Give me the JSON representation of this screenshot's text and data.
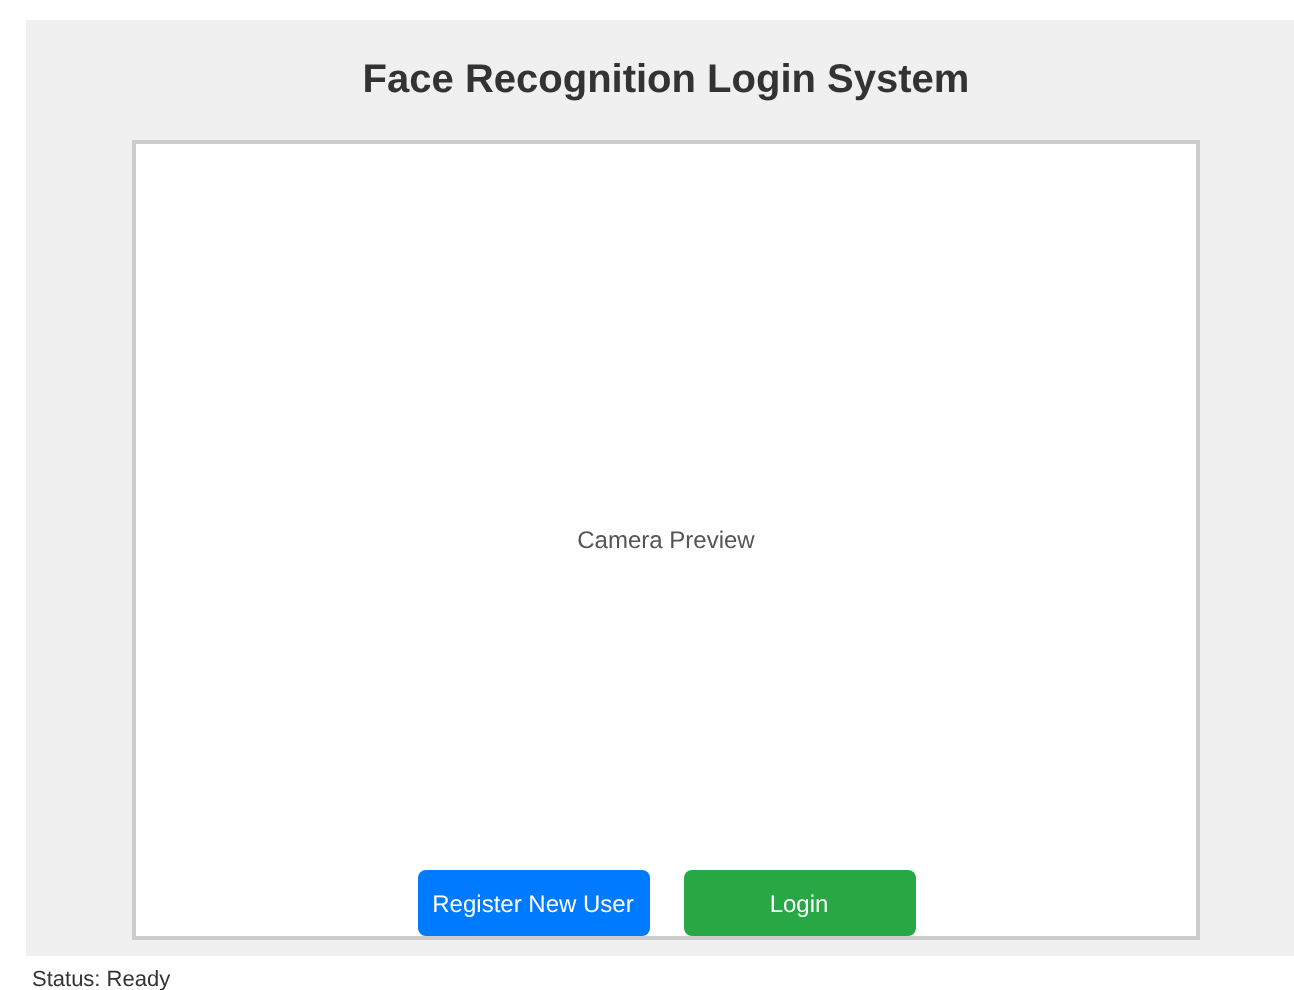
{
  "window": {
    "title": "Face Recognition Login System"
  },
  "preview": {
    "label": "Camera Preview"
  },
  "buttons": [
    {
      "label": "Register New User",
      "kind": "primary"
    },
    {
      "label": "Login",
      "kind": "success"
    }
  ],
  "status_bar": {
    "text": "Status: Ready"
  }
}
